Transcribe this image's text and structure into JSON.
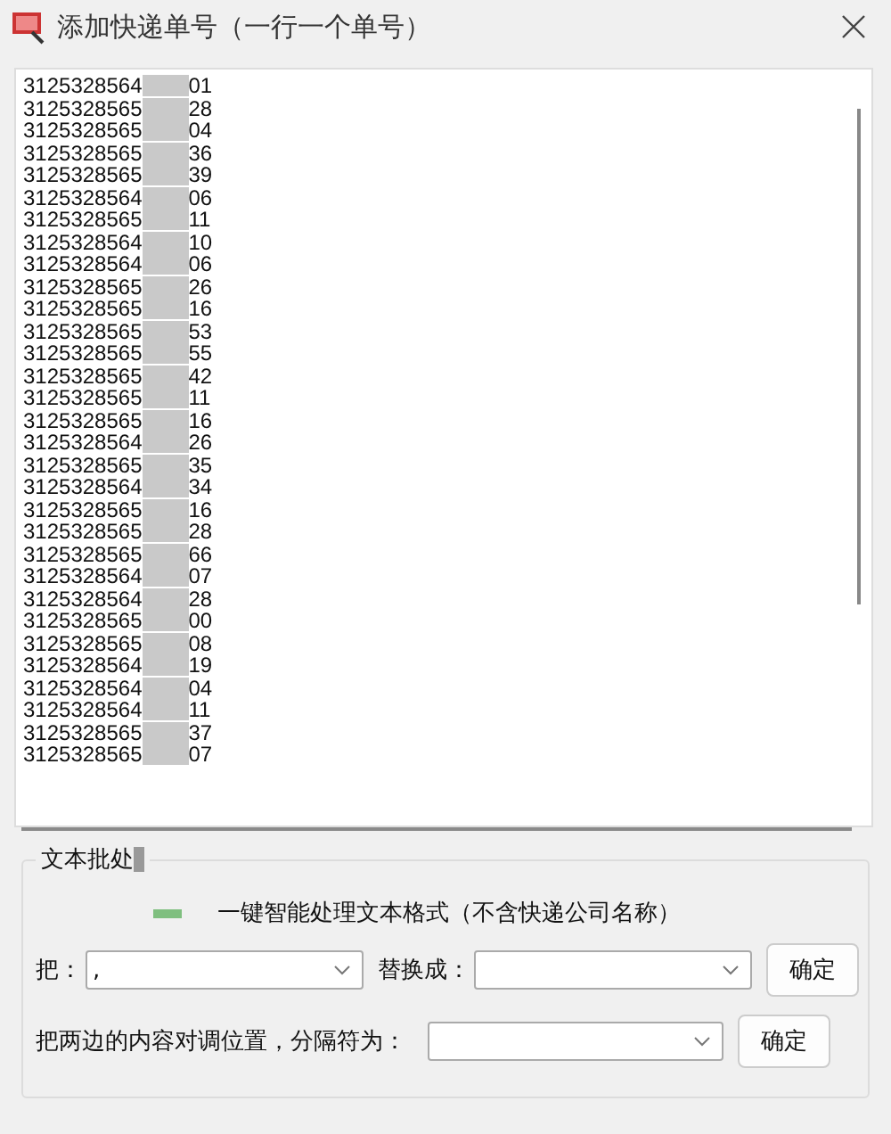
{
  "window": {
    "title": "添加快递单号（一行一个单号）"
  },
  "numbers": [
    {
      "prefix": "3125328564",
      "suffix": "01"
    },
    {
      "prefix": "3125328565",
      "suffix": "28"
    },
    {
      "prefix": "3125328565",
      "suffix": "04"
    },
    {
      "prefix": "3125328565",
      "suffix": "36"
    },
    {
      "prefix": "3125328565",
      "suffix": "39"
    },
    {
      "prefix": "3125328564",
      "suffix": "06"
    },
    {
      "prefix": "3125328565",
      "suffix": "11"
    },
    {
      "prefix": "3125328564",
      "suffix": "10"
    },
    {
      "prefix": "3125328564",
      "suffix": "06"
    },
    {
      "prefix": "3125328565",
      "suffix": "26"
    },
    {
      "prefix": "3125328565",
      "suffix": "16"
    },
    {
      "prefix": "3125328565",
      "suffix": "53"
    },
    {
      "prefix": "3125328565",
      "suffix": "55"
    },
    {
      "prefix": "3125328565",
      "suffix": "42"
    },
    {
      "prefix": "3125328565",
      "suffix": "11"
    },
    {
      "prefix": "3125328565",
      "suffix": "16"
    },
    {
      "prefix": "3125328564",
      "suffix": "26"
    },
    {
      "prefix": "3125328565",
      "suffix": "35"
    },
    {
      "prefix": "3125328564",
      "suffix": "34"
    },
    {
      "prefix": "3125328565",
      "suffix": "16"
    },
    {
      "prefix": "3125328565",
      "suffix": "28"
    },
    {
      "prefix": "3125328565",
      "suffix": "66"
    },
    {
      "prefix": "3125328564",
      "suffix": "07"
    },
    {
      "prefix": "3125328564",
      "suffix": "28"
    },
    {
      "prefix": "3125328565",
      "suffix": "00"
    },
    {
      "prefix": "3125328565",
      "suffix": "08"
    },
    {
      "prefix": "3125328564",
      "suffix": "19"
    },
    {
      "prefix": "3125328564",
      "suffix": "04"
    },
    {
      "prefix": "3125328564",
      "suffix": "11"
    },
    {
      "prefix": "3125328565",
      "suffix": "37"
    },
    {
      "prefix": "3125328565",
      "suffix": "07"
    }
  ],
  "batch": {
    "title": "文本批处",
    "smart_label": "一键智能处理文本格式（不含快递公司名称）",
    "replace": {
      "from_label": "把：",
      "from_value": ",",
      "to_label": "替换成：",
      "button": "确定"
    },
    "swap": {
      "label": "把两边的内容对调位置，分隔符为：",
      "button": "确定"
    }
  }
}
